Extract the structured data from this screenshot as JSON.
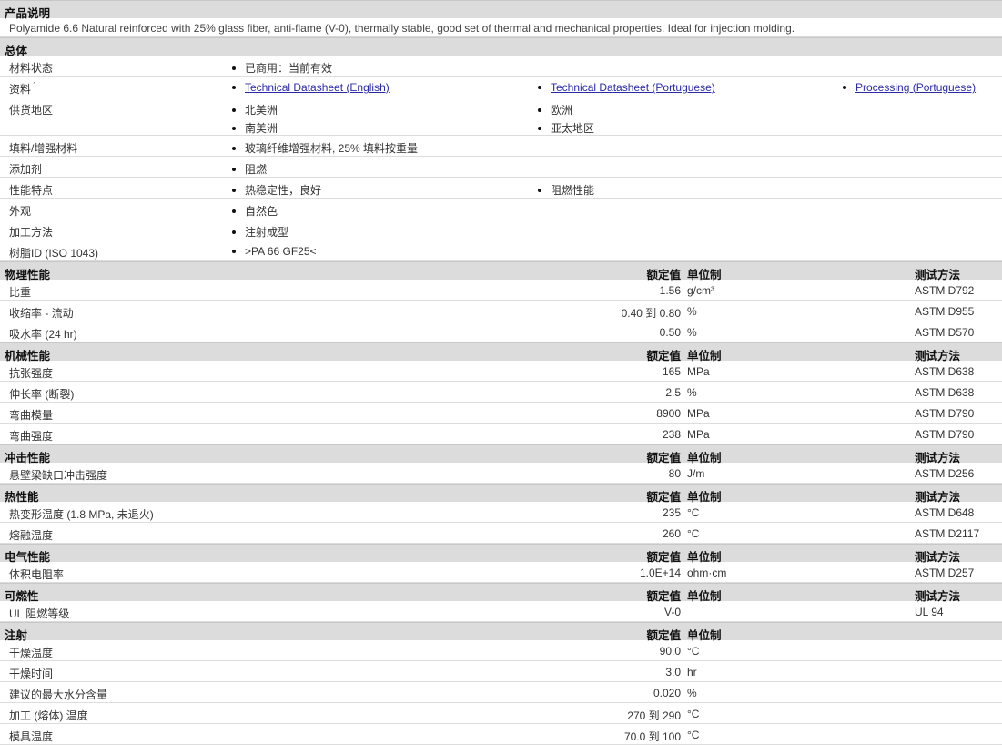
{
  "product": {
    "title": "产品说明",
    "description": "Polyamide 6.6 Natural reinforced with 25% glass fiber, anti-flame (V-0), thermally stable, good set of thermal and mechanical properties. Ideal for injection molding."
  },
  "general": {
    "title": "总体",
    "rows": {
      "status": {
        "label": "材料状态",
        "items": [
          "已商用：当前有效"
        ]
      },
      "docs": {
        "label": "资料",
        "sup": "1",
        "items": [
          "Technical Datasheet (English)",
          "Technical Datasheet (Portuguese)",
          "Processing (Portuguese)"
        ]
      },
      "regions": {
        "label": "供货地区",
        "items": [
          "北美洲",
          "欧洲",
          "南美洲",
          "亚太地区"
        ]
      },
      "filler": {
        "label": "填料/增强材料",
        "items": [
          "玻璃纤维增强材料, 25% 填料按重量"
        ]
      },
      "additive": {
        "label": "添加剂",
        "items": [
          "阻燃"
        ]
      },
      "features": {
        "label": "性能特点",
        "items": [
          "热稳定性，良好",
          "阻燃性能"
        ]
      },
      "appearance": {
        "label": "外观",
        "items": [
          "自然色"
        ]
      },
      "processing": {
        "label": "加工方法",
        "items": [
          "注射成型"
        ]
      },
      "resin_id": {
        "label": "树脂ID (ISO 1043)",
        "items": [
          ">PA 66 GF25<"
        ]
      }
    }
  },
  "headers": {
    "nominal": "额定值",
    "unit": "单位制",
    "method": "测试方法"
  },
  "physical": {
    "title": "物理性能",
    "rows": [
      {
        "label": "比重",
        "value": "1.56",
        "unit": "g/cm³",
        "method": "ASTM D792"
      },
      {
        "label": "收缩率 - 流动",
        "value": "0.40 到  0.80",
        "unit": "%",
        "method": "ASTM D955"
      },
      {
        "label": "吸水率 (24 hr)",
        "value": "0.50",
        "unit": "%",
        "method": "ASTM D570"
      }
    ]
  },
  "mechanical": {
    "title": "机械性能",
    "rows": [
      {
        "label": "抗张强度",
        "value": "165",
        "unit": "MPa",
        "method": "ASTM D638"
      },
      {
        "label": "伸长率 (断裂)",
        "value": "2.5",
        "unit": "%",
        "method": "ASTM D638"
      },
      {
        "label": "弯曲模量",
        "value": "8900",
        "unit": "MPa",
        "method": "ASTM D790"
      },
      {
        "label": "弯曲强度",
        "value": "238",
        "unit": "MPa",
        "method": "ASTM D790"
      }
    ]
  },
  "impact": {
    "title": "冲击性能",
    "rows": [
      {
        "label": "悬壁梁缺口冲击强度",
        "value": "80",
        "unit": "J/m",
        "method": "ASTM D256"
      }
    ]
  },
  "thermal": {
    "title": "热性能",
    "rows": [
      {
        "label": "热变形温度 (1.8 MPa, 未退火)",
        "value": "235",
        "unit": "°C",
        "method": "ASTM D648"
      },
      {
        "label": "熔融温度",
        "value": "260",
        "unit": "°C",
        "method": "ASTM D2117"
      }
    ]
  },
  "electrical": {
    "title": "电气性能",
    "rows": [
      {
        "label": "体积电阻率",
        "value": "1.0E+14",
        "unit": "ohm·cm",
        "method": "ASTM D257"
      }
    ]
  },
  "flammability": {
    "title": "可燃性",
    "rows": [
      {
        "label": "UL 阻燃等级",
        "value": "V-0",
        "unit": "",
        "method": "UL 94"
      }
    ]
  },
  "injection": {
    "title": "注射",
    "rows": [
      {
        "label": "干燥温度",
        "value": "90.0",
        "unit": "°C"
      },
      {
        "label": "干燥时间",
        "value": "3.0",
        "unit": "hr"
      },
      {
        "label": "建议的最大水分含量",
        "value": "0.020",
        "unit": "%"
      },
      {
        "label": "加工 (熔体) 温度",
        "value": "270 到  290",
        "unit": "°C"
      },
      {
        "label": "模具温度",
        "value": "70.0 到  100",
        "unit": "°C"
      }
    ]
  }
}
